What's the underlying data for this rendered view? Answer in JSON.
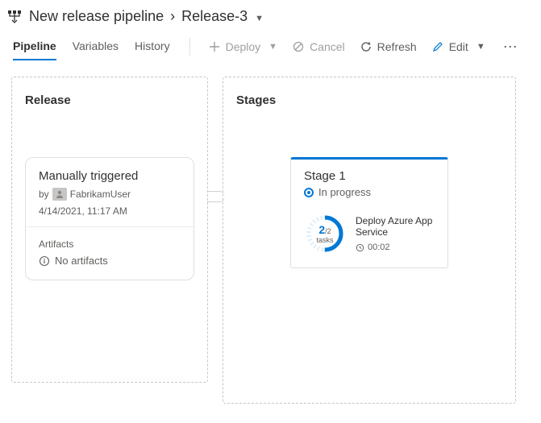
{
  "breadcrumb": {
    "pipeline_name": "New release pipeline",
    "release_name": "Release-3"
  },
  "tabs": [
    {
      "label": "Pipeline",
      "active": true
    },
    {
      "label": "Variables",
      "active": false
    },
    {
      "label": "History",
      "active": false
    }
  ],
  "actions": {
    "deploy": "Deploy",
    "cancel": "Cancel",
    "refresh": "Refresh",
    "edit": "Edit"
  },
  "release_panel": {
    "title": "Release",
    "trigger_label": "Manually triggered",
    "by_label": "by",
    "user": "FabrikamUser",
    "timestamp": "4/14/2021, 11:17 AM",
    "artifacts_label": "Artifacts",
    "no_artifacts": "No artifacts"
  },
  "stages_panel": {
    "title": "Stages",
    "stage": {
      "name": "Stage 1",
      "status": "In progress",
      "progress_current": "2",
      "progress_total": "/2",
      "tasks_label": "tasks",
      "task_name": "Deploy Azure App Service",
      "elapsed": "00:02"
    }
  }
}
